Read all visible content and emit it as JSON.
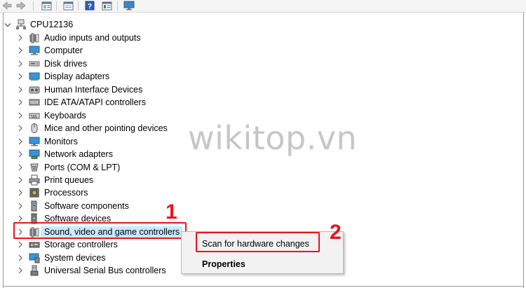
{
  "toolbar": {
    "buttons": [
      "back-icon",
      "forward-icon",
      "properties-icon",
      "show-hide-icon",
      "help-icon",
      "view-icon",
      "monitor-icon"
    ]
  },
  "tree": {
    "root": {
      "label": "CPU12136",
      "icon": "computer-network-icon"
    },
    "items": [
      {
        "label": "Audio inputs and outputs",
        "icon": "speaker-icon"
      },
      {
        "label": "Computer",
        "icon": "monitor-icon"
      },
      {
        "label": "Disk drives",
        "icon": "disk-drive-icon"
      },
      {
        "label": "Display adapters",
        "icon": "display-adapter-icon"
      },
      {
        "label": "Human Interface Devices",
        "icon": "hid-icon"
      },
      {
        "label": "IDE ATA/ATAPI controllers",
        "icon": "ide-controller-icon"
      },
      {
        "label": "Keyboards",
        "icon": "keyboard-icon"
      },
      {
        "label": "Mice and other pointing devices",
        "icon": "mouse-icon"
      },
      {
        "label": "Monitors",
        "icon": "monitor-icon"
      },
      {
        "label": "Network adapters",
        "icon": "network-adapter-icon"
      },
      {
        "label": "Ports (COM & LPT)",
        "icon": "port-icon"
      },
      {
        "label": "Print queues",
        "icon": "printer-icon"
      },
      {
        "label": "Processors",
        "icon": "processor-icon"
      },
      {
        "label": "Software components",
        "icon": "software-component-icon"
      },
      {
        "label": "Software devices",
        "icon": "software-device-icon"
      },
      {
        "label": "Sound, video and game controllers",
        "icon": "speaker-icon",
        "selected": true
      },
      {
        "label": "Storage controllers",
        "icon": "storage-controller-icon"
      },
      {
        "label": "System devices",
        "icon": "system-device-icon"
      },
      {
        "label": "Universal Serial Bus controllers",
        "icon": "usb-icon"
      }
    ]
  },
  "context_menu": {
    "items": [
      {
        "label": "Scan for hardware changes",
        "bold": false
      },
      {
        "label": "Properties",
        "bold": true
      }
    ]
  },
  "callouts": {
    "step1": "1",
    "step2": "2"
  },
  "watermark": "wikitop.vn",
  "colors": {
    "highlight": "#cce8ff",
    "callout": "#e8151b"
  }
}
